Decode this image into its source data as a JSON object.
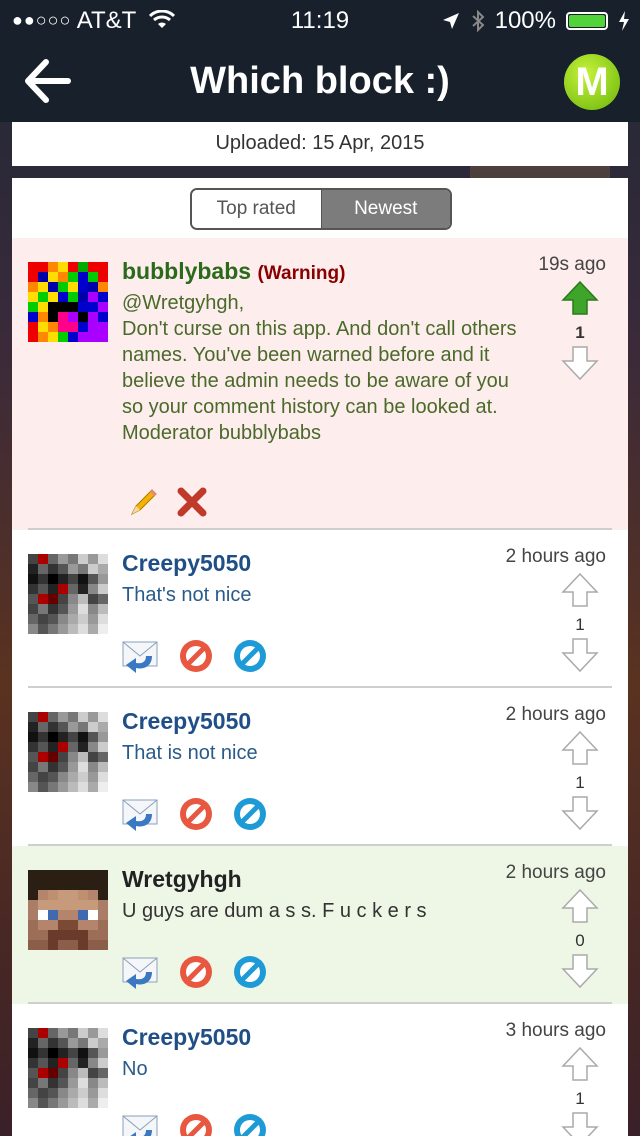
{
  "status": {
    "carrier": "AT&T",
    "signal_dots": "●●○○○",
    "time": "11:19",
    "battery": "100%"
  },
  "nav": {
    "title": "Which block :)",
    "logo_letter": "M"
  },
  "uploaded": "Uploaded: 15 Apr, 2015",
  "tabs": [
    {
      "label": "Top rated",
      "selected": false
    },
    {
      "label": "Newest",
      "selected": true
    }
  ],
  "comments": [
    {
      "user": "bubblybabs",
      "badge": "(Warning)",
      "time": "19s ago",
      "text": "@Wretgyhgh,\nDon't curse on this app. And don't call others names. You've been warned before and it believe the admin needs to be aware of you so your comment history can be looked at.\nModerator bubblybabs",
      "votes": "1",
      "upvoted": true,
      "background": "#fdeded",
      "name_color": "#2a6a1a",
      "text_color": "#4a6a2a",
      "actions": [
        "edit-icon",
        "delete-icon"
      ]
    },
    {
      "user": "Creepy5050",
      "time": "2 hours ago",
      "text": "That's not nice",
      "votes": "1",
      "background": "#ffffff",
      "name_color": "#1f4f86",
      "text_color": "#2a5a8a",
      "actions": [
        "reply-icon",
        "block-icon",
        "report-icon"
      ]
    },
    {
      "user": "Creepy5050",
      "time": "2 hours ago",
      "text": "That is not nice",
      "votes": "1",
      "background": "#ffffff",
      "name_color": "#1f4f86",
      "text_color": "#2a5a8a",
      "actions": [
        "reply-icon",
        "block-icon",
        "report-icon"
      ]
    },
    {
      "user": "Wretgyhgh",
      "time": "2 hours ago",
      "text": "U guys are dum a s s. F u c k e r s",
      "votes": "0",
      "background": "#eef7e6",
      "name_color": "#222222",
      "text_color": "#333333",
      "actions": [
        "reply-icon",
        "block-icon",
        "report-icon"
      ]
    },
    {
      "user": "Creepy5050",
      "time": "3 hours ago",
      "text": "No",
      "votes": "1",
      "background": "#ffffff",
      "name_color": "#1f4f86",
      "text_color": "#2a5a8a",
      "actions": [
        "reply-icon",
        "block-icon",
        "report-icon"
      ]
    }
  ]
}
